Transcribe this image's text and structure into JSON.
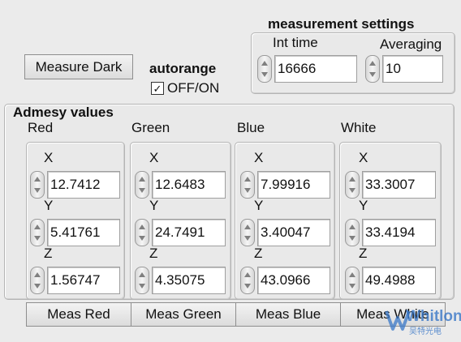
{
  "buttons": {
    "measure_dark": "Measure Dark",
    "meas_red": "Meas Red",
    "meas_green": "Meas Green",
    "meas_blue": "Meas Blue",
    "meas_white": "Meas White"
  },
  "autorange": {
    "title": "autorange",
    "checkbox_label": "OFF/ON",
    "checked": true,
    "check_glyph": "✓"
  },
  "measurement_settings": {
    "title": "measurement settings",
    "int_time_label": "Int time",
    "int_time_value": "16666",
    "averaging_label": "Averaging",
    "averaging_value": "10"
  },
  "admesy": {
    "title": "Admesy values",
    "channels": [
      {
        "name": "Red",
        "x_label": "X",
        "y_label": "Y",
        "z_label": "Z",
        "x": "12.7412",
        "y": "5.41761",
        "z": "1.56747"
      },
      {
        "name": "Green",
        "x_label": "X",
        "y_label": "Y",
        "z_label": "Z",
        "x": "12.6483",
        "y": "24.7491",
        "z": "4.35075"
      },
      {
        "name": "Blue",
        "x_label": "X",
        "y_label": "Y",
        "z_label": "Z",
        "x": "7.99916",
        "y": "3.40047",
        "z": "43.0966"
      },
      {
        "name": "White",
        "x_label": "X",
        "y_label": "Y",
        "z_label": "Z",
        "x": "33.3007",
        "y": "33.4194",
        "z": "49.4988"
      }
    ]
  },
  "watermark": {
    "text": "Whitlon",
    "subtext": "吴特光电",
    "color": "#3a78c8"
  }
}
